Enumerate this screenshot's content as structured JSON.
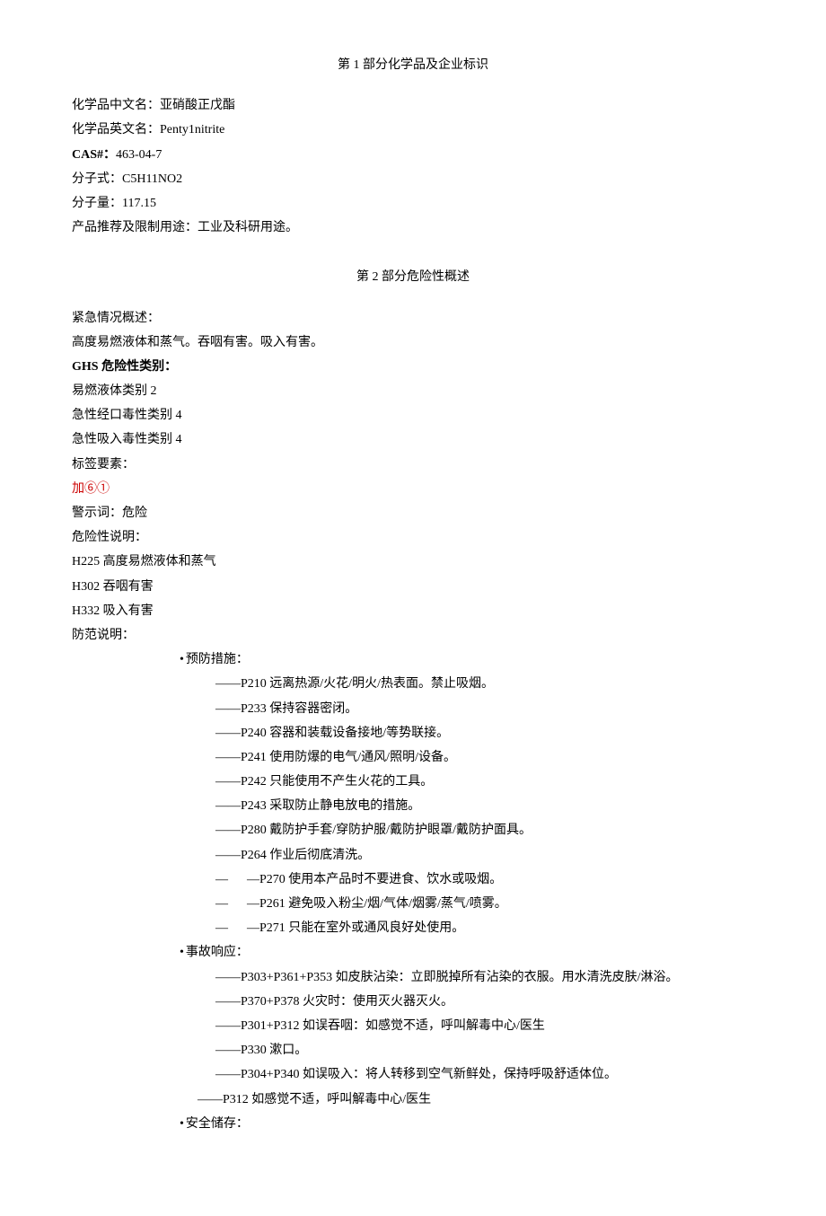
{
  "section1": {
    "title": "第 1 部分化学品及企业标识",
    "chinese_name_label": "化学品中文名：",
    "chinese_name": "亚硝酸正戊酯",
    "english_name_label": "化学品英文名：",
    "english_name": "Penty1nitrite",
    "cas_label": "CAS#：",
    "cas": "463-04-7",
    "formula_label": "分子式：",
    "formula": "C5H11NO2",
    "weight_label": "分子量：",
    "weight": "117.15",
    "usage_label": "产品推荐及限制用途：",
    "usage": "工业及科研用途。"
  },
  "section2": {
    "title": "第 2 部分危险性概述",
    "emergency_label": "紧急情况概述：",
    "emergency_text": "高度易燃液体和蒸气。吞咽有害。吸入有害。",
    "ghs_label": "GHS 危险性类别：",
    "ghs_cat1": "易燃液体类别 2",
    "ghs_cat2": "急性经口毒性类别 4",
    "ghs_cat3": "急性吸入毒性类别 4",
    "label_elements": "标签要素：",
    "pictogram": "加⑥①",
    "signal_word_label": "警示词：",
    "signal_word": "危险",
    "hazard_label": "危险性说明：",
    "h225": "H225 高度易燃液体和蒸气",
    "h302": "H302 吞咽有害",
    "h332": "H332 吸入有害",
    "precaution_label": "防范说明：",
    "prevention": {
      "title": "预防措施：",
      "p210": "P210 远离热源/火花/明火/热表面。禁止吸烟。",
      "p233": "P233 保持容器密闭。",
      "p240": "P240 容器和装载设备接地/等势联接。",
      "p241": "P241 使用防爆的电气/通风/照明/设备。",
      "p242": "P242 只能使用不产生火花的工具。",
      "p243": "P243 采取防止静电放电的措施。",
      "p280": "P280 戴防护手套/穿防护服/戴防护眼罩/戴防护面具。",
      "p264": "P264 作业后彻底清洗。",
      "p270": "P270 使用本产品时不要进食、饮水或吸烟。",
      "p261": "P261 避免吸入粉尘/烟/气体/烟雾/蒸气/喷雾。",
      "p271": "P271 只能在室外或通风良好处使用。"
    },
    "response": {
      "title": "事故响应：",
      "p303": "P303+P361+P353 如皮肤沾染：立即脱掉所有沾染的衣服。用水清洗皮肤/淋浴。",
      "p370": "P370+P378 火灾时：使用灭火器灭火。",
      "p301": "P301+P312 如误吞咽：如感觉不适，呼叫解毒中心/医生",
      "p330": "P330 漱口。",
      "p304": "P304+P340 如误吸入：将人转移到空气新鲜处，保持呼吸舒适体位。",
      "p312": "P312 如感觉不适，呼叫解毒中心/医生"
    },
    "storage": {
      "title": "安全储存："
    }
  }
}
